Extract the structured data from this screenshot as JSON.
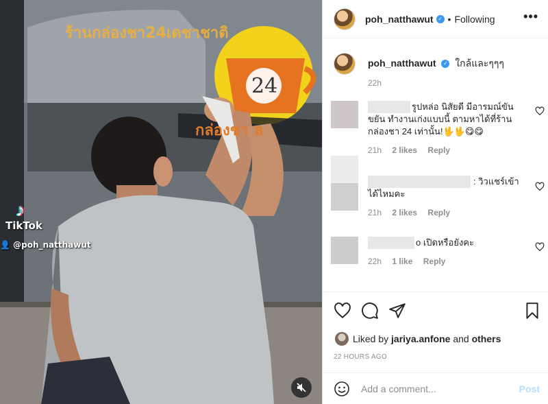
{
  "media": {
    "shop_sign_text": "ร้านกล่องชา24เดชาชาติ",
    "cup_number": "24",
    "window_text": "กล่องชา ล",
    "watermark": {
      "logo_label": "TikTok",
      "username": "@poh_natthawut"
    }
  },
  "header": {
    "username": "poh_natthawut",
    "separator": "•",
    "follow_status": "Following",
    "more_label": "•••"
  },
  "caption": {
    "username": "poh_natthawut",
    "text": "ใกล้และๆๆๆ",
    "time": "22h"
  },
  "comments": [
    {
      "prefix_visible": "ร",
      "text_line1": "รูปหล่อ นิสัยดี มีอารมณ์ขัน",
      "text_line2": "ขยัน ทำงานเก่งแบบนี้ ตามหาได้ที่ร้าน",
      "text_line3": "กล่องชา 24 เท่านั้น!🖖🖖😋😋",
      "time": "21h",
      "likes": "2 likes",
      "reply": "Reply"
    },
    {
      "text_line1": ": วิวแชร์เข้า",
      "text_line2": "ได้ไหมคะ",
      "time": "21h",
      "likes": "2 likes",
      "reply": "Reply"
    },
    {
      "text_line1": "o เปิดหรือยังคะ",
      "time": "22h",
      "likes": "1 like",
      "reply": "Reply"
    }
  ],
  "actions": {
    "icons": [
      "heart-icon",
      "comment-icon",
      "share-icon",
      "bookmark-icon"
    ],
    "liked_by_prefix": "Liked by",
    "liked_by_user": "jariya.anfone",
    "liked_by_and": "and",
    "liked_by_others": "others",
    "post_time": "22 HOURS AGO"
  },
  "add_comment": {
    "placeholder": "Add a comment...",
    "post_label": "Post"
  },
  "colors": {
    "verified": "#3897f0",
    "post_disabled": "#b2dffc",
    "secondary_text": "#8e8e8e"
  }
}
